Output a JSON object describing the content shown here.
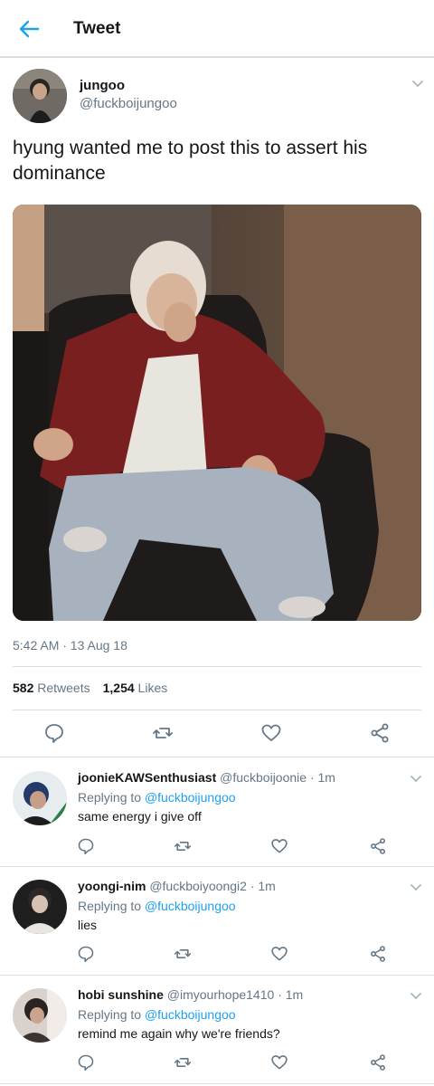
{
  "header": {
    "title": "Tweet"
  },
  "tweet": {
    "author_name": "jungoo",
    "author_handle": "@fuckboijungoo",
    "text": "hyung wanted me to post this to assert his dominance",
    "timestamp": "5:42 AM · 13 Aug 18",
    "retweets_count": "582",
    "retweets_label": "Retweets",
    "likes_count": "1,254",
    "likes_label": "Likes"
  },
  "replies": [
    {
      "name": "joonieKAWSenthusiast",
      "handle": "@fuckboijoonie",
      "time": "· 1m",
      "replying_prefix": "Replying to",
      "replying_to": "@fuckboijungoo",
      "text": "same energy i give off"
    },
    {
      "name": "yoongi-nim",
      "handle": "@fuckboiyoongi2",
      "time": "· 1m",
      "replying_prefix": "Replying to",
      "replying_to": "@fuckboijungoo",
      "text": "lies"
    },
    {
      "name": "hobi sunshine",
      "handle": "@imyourhope1410",
      "time": "· 1m",
      "replying_prefix": "Replying to",
      "replying_to": "@fuckboijungoo",
      "text": "remind me again why we're friends?"
    }
  ],
  "icons": {
    "back": "arrow-left-icon",
    "more": "chevron-down-icon",
    "reply": "comment-icon",
    "retweet": "retweet-icon",
    "like": "heart-icon",
    "share": "share-icon"
  },
  "colors": {
    "accent": "#1da1f2",
    "secondary_text": "#657786",
    "divider": "#d8dde1"
  }
}
